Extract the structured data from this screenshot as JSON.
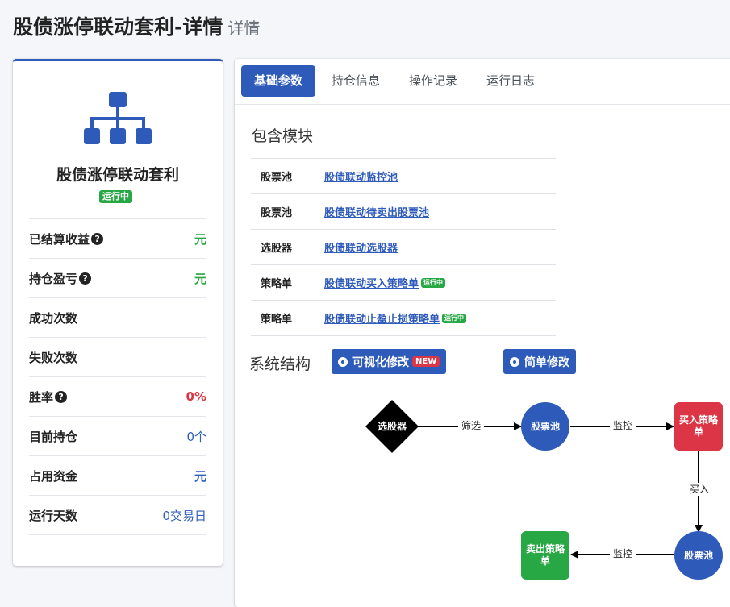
{
  "page": {
    "title": "股债涨停联动套利-详情",
    "subtitle": "详情"
  },
  "strategy": {
    "name": "股债涨停联动套利",
    "status": "运行中",
    "stats": [
      {
        "label": "已结算收益",
        "help": true,
        "value": "元"
      },
      {
        "label": "持仓盈亏",
        "help": true,
        "value": "元"
      },
      {
        "label": "成功次数",
        "help": false,
        "value": ""
      },
      {
        "label": "失败次数",
        "help": false,
        "value": ""
      },
      {
        "label": "胜率",
        "help": true,
        "value": "0%"
      },
      {
        "label": "目前持仓",
        "help": false,
        "value": "0个"
      },
      {
        "label": "占用资金",
        "help": false,
        "value": "元"
      },
      {
        "label": "运行天数",
        "help": false,
        "value": "0交易日"
      }
    ]
  },
  "tabs": [
    "基础参数",
    "持仓信息",
    "操作记录",
    "运行日志"
  ],
  "modules": {
    "title": "包含模块",
    "rows": [
      {
        "type": "股票池",
        "name": "股债联动监控池",
        "badge": ""
      },
      {
        "type": "股票池",
        "name": "股债联动待卖出股票池",
        "badge": ""
      },
      {
        "type": "选股器",
        "name": "股债联动选股器",
        "badge": ""
      },
      {
        "type": "策略单",
        "name": "股债联动买入策略单",
        "badge": "运行中"
      },
      {
        "type": "策略单",
        "name": "股债联动止盈止损策略单",
        "badge": "运行中"
      }
    ]
  },
  "structure": {
    "title": "系统结构",
    "visual_edit": "可视化修改",
    "new_badge": "NEW",
    "simple_edit": "简单修改",
    "nodes": {
      "selector": "选股器",
      "pool1": "股票池",
      "buy": "买入策略单",
      "pool2": "股票池",
      "sell": "卖出策略单"
    },
    "edges": {
      "filter": "筛选",
      "monitor1": "监控",
      "buy": "买入",
      "monitor2": "监控"
    }
  },
  "colors": {
    "primary": "#2e5bba",
    "success": "#28a745",
    "danger": "#dc3545"
  },
  "icons": [
    "sitemap-icon",
    "question-circle-icon",
    "radio-dot-icon"
  ]
}
